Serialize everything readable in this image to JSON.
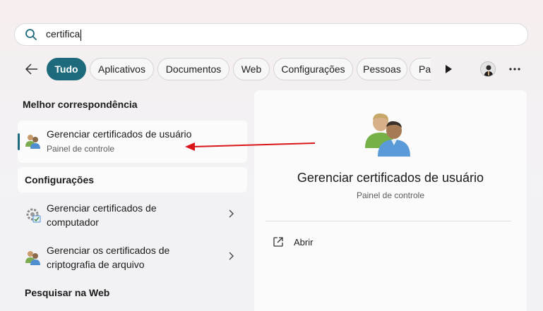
{
  "search": {
    "query": "certifica"
  },
  "filters": {
    "chips": [
      "Tudo",
      "Aplicativos",
      "Documentos",
      "Web",
      "Configurações",
      "Pessoas",
      "Pas"
    ],
    "active": "Tudo"
  },
  "best_match": {
    "heading": "Melhor correspondência",
    "item": {
      "title": "Gerenciar certificados de usuário",
      "subtitle": "Painel de controle",
      "icon": "users-icon"
    }
  },
  "settings": {
    "heading": "Configurações",
    "items": [
      {
        "line1": "Gerenciar certificados de",
        "line2": "computador",
        "icon": "settings-certificate-icon"
      },
      {
        "line1": "Gerenciar os certificados de",
        "line2": "criptografia de arquivo",
        "icon": "users-icon"
      }
    ]
  },
  "web_search": {
    "heading": "Pesquisar na Web"
  },
  "detail": {
    "title": "Gerenciar certificados de usuário",
    "subtitle": "Painel de controle",
    "actions": [
      {
        "label": "Abrir",
        "icon": "open-external-icon"
      }
    ]
  },
  "colors": {
    "accent": "#1c6a7c",
    "annotation": "#d9161a"
  }
}
